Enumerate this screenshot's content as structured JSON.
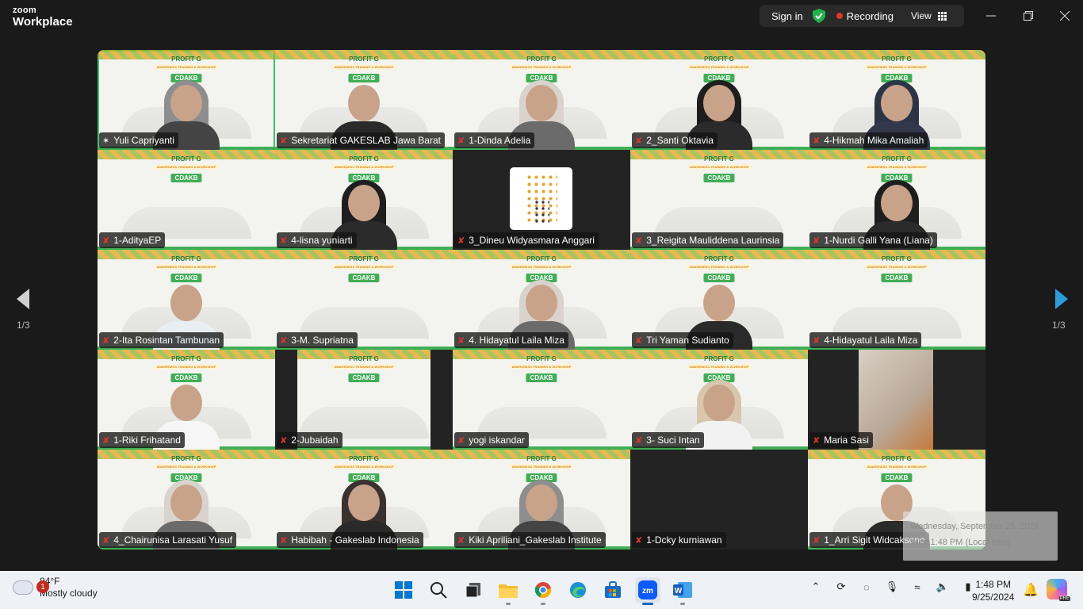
{
  "app": {
    "logo_top": "zoom",
    "logo_bottom": "Workplace"
  },
  "toolbar": {
    "sign_in": "Sign in",
    "recording": "Recording",
    "view": "View"
  },
  "gallery": {
    "page_label": "1/3",
    "banner_brand": "PROFIT G",
    "banner_sub": "AWARENESS TRAINING & WORKSHOP",
    "banner_cdakb": "CDAKB",
    "participants": [
      {
        "name": "Yuli Capriyanti",
        "pinned": true,
        "video": "hijab-grey"
      },
      {
        "name": "Sekretariat GAKESLAB Jawa Barat",
        "pinned": false,
        "video": "person-dark"
      },
      {
        "name": "1-Dinda Adelia",
        "pinned": false,
        "video": "hijab-light"
      },
      {
        "name": "2_Santi Oktavia",
        "pinned": false,
        "video": "hijab-black"
      },
      {
        "name": "4-Hikmah Mika Amaliah",
        "pinned": false,
        "video": "hijab-navy"
      },
      {
        "name": "1-AdityaEP",
        "pinned": false,
        "video": "none"
      },
      {
        "name": "4-lisna yuniarti",
        "pinned": false,
        "video": "hijab-black"
      },
      {
        "name": "3_Dineu Widyasmara Anggari",
        "pinned": false,
        "video": "logo"
      },
      {
        "name": "3_Reigita Mauliddena Laurinsia",
        "pinned": false,
        "video": "none"
      },
      {
        "name": "1-Nurdi Galli Yana (Liana)",
        "pinned": false,
        "video": "hijab-black"
      },
      {
        "name": "2-Ita Rosintan Tambunan",
        "pinned": false,
        "video": "person-light"
      },
      {
        "name": "3-M. Supriatna",
        "pinned": false,
        "video": "none"
      },
      {
        "name": "4. Hidayatul Laila Miza",
        "pinned": false,
        "video": "hijab-light"
      },
      {
        "name": "Tri Yaman Sudianto",
        "pinned": false,
        "video": "person-dark"
      },
      {
        "name": "4-Hidayatul Laila Miza",
        "pinned": false,
        "video": "none"
      },
      {
        "name": "1-Riki Frihatand",
        "pinned": false,
        "video": "person-white"
      },
      {
        "name": "2-Jubaidah",
        "pinned": false,
        "video": "pillarbox"
      },
      {
        "name": "yogi iskandar",
        "pinned": false,
        "video": "none"
      },
      {
        "name": "3- Suci Intan",
        "pinned": false,
        "video": "hijab-beige"
      },
      {
        "name": "Maria Sasi",
        "pinned": false,
        "video": "room"
      },
      {
        "name": "4_Chairunisa Larasati Yusuf",
        "pinned": false,
        "video": "hijab-light"
      },
      {
        "name": "Habibah - Gakeslab Indonesia",
        "pinned": false,
        "video": "hijab-dark"
      },
      {
        "name": "Kiki Apriliani_Gakeslab Institute",
        "pinned": false,
        "video": "hijab-grey"
      },
      {
        "name": "1-Dcky kurniawan",
        "pinned": false,
        "video": "off"
      },
      {
        "name": "1_Arri Sigit Widcaksono",
        "pinned": false,
        "video": "person-dark"
      }
    ]
  },
  "tooltip": {
    "line1": "Wednesday, September 25, 2024",
    "line2": "Wed 1:48 PM (Local time)"
  },
  "taskbar": {
    "weather_badge": "1",
    "temperature": "84°F",
    "condition": "Mostly cloudy",
    "time": "1:48 PM",
    "date": "9/25/2024",
    "copilot_badge": "PRE"
  },
  "colors": {
    "accent_green": "#3ac270",
    "recording_red": "#e0352b",
    "zoom_blue": "#0b5cff",
    "arrow_blue": "#2d9cdb"
  }
}
